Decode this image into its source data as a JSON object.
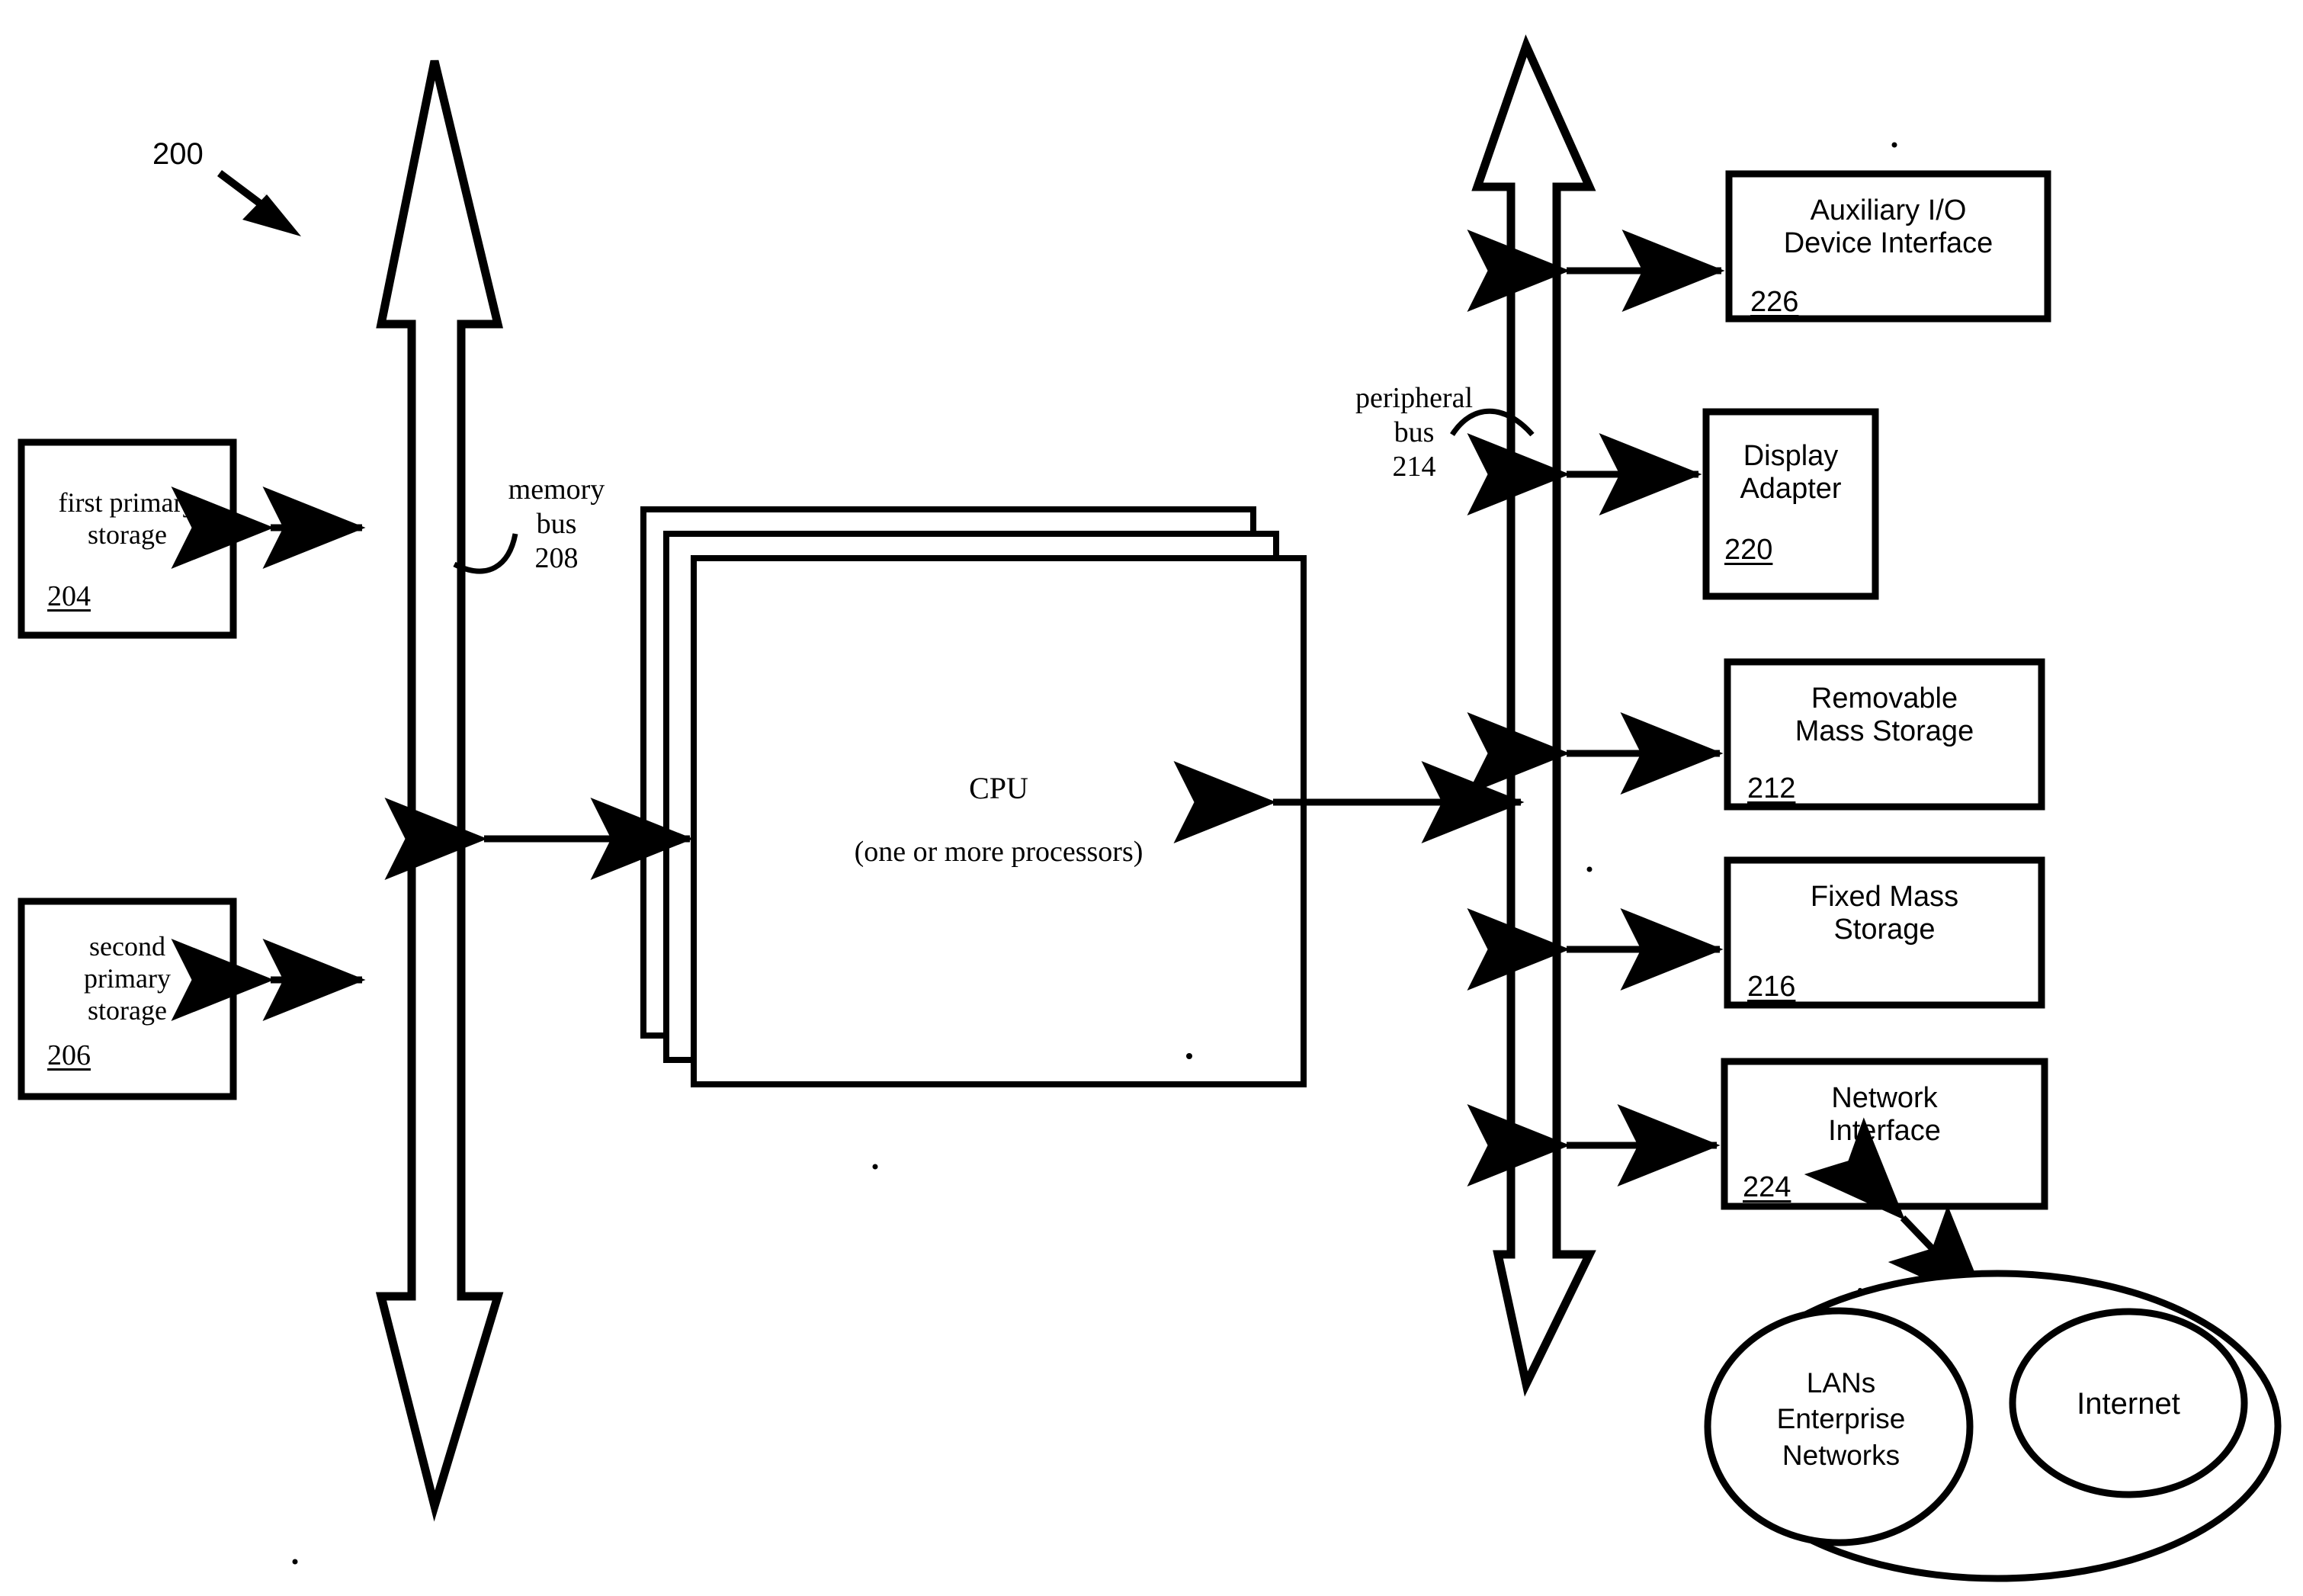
{
  "figure": {
    "reference_numeral": "200"
  },
  "left_boxes": [
    {
      "name": "first-primary-storage",
      "lines": [
        "first primary",
        "storage"
      ],
      "ref": "204"
    },
    {
      "name": "second-primary-storage",
      "lines": [
        "second",
        "primary",
        "storage"
      ],
      "ref": "206"
    }
  ],
  "buses": [
    {
      "name": "memory-bus",
      "lines": [
        "memory",
        "bus",
        "208"
      ]
    },
    {
      "name": "peripheral-bus",
      "lines": [
        "peripheral",
        "bus",
        "214"
      ]
    }
  ],
  "cpu": {
    "title": "CPU",
    "subtitle": "(one or more processors)"
  },
  "right_boxes": [
    {
      "name": "auxiliary-io-device-interface",
      "lines": [
        "Auxiliary I/O",
        "Device Interface"
      ],
      "ref": "226"
    },
    {
      "name": "display-adapter",
      "lines": [
        "Display",
        "Adapter"
      ],
      "ref": "220"
    },
    {
      "name": "removable-mass-storage",
      "lines": [
        "Removable",
        "Mass Storage"
      ],
      "ref": "212"
    },
    {
      "name": "fixed-mass-storage",
      "lines": [
        "Fixed Mass",
        "Storage"
      ],
      "ref": "216"
    },
    {
      "name": "network-interface",
      "lines": [
        "Network",
        "Interface"
      ],
      "ref": "224"
    }
  ],
  "network_cloud": {
    "lan_ellipse": {
      "lines": [
        "LANs",
        "Enterprise",
        "Networks"
      ]
    },
    "internet_ellipse": {
      "lines": [
        "Internet"
      ]
    }
  },
  "colors": {
    "ink": "#000000",
    "paper": "#ffffff"
  }
}
